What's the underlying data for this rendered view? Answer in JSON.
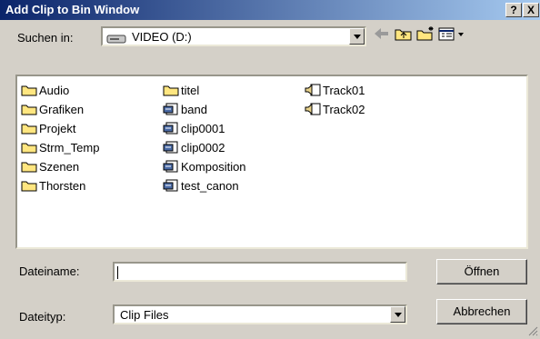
{
  "window": {
    "title": "Add Clip to Bin Window",
    "help_label": "?",
    "close_label": "X"
  },
  "lookin": {
    "label": "Suchen in:",
    "value": "VIDEO (D:)"
  },
  "toolbar": {
    "back_icon": "back-arrow-icon",
    "up_icon": "up-folder-icon",
    "newfolder_icon": "new-folder-icon",
    "view_icon": "view-menu-icon"
  },
  "files": [
    {
      "name": "Audio",
      "type": "folder"
    },
    {
      "name": "Grafiken",
      "type": "folder"
    },
    {
      "name": "Projekt",
      "type": "folder"
    },
    {
      "name": "Strm_Temp",
      "type": "folder"
    },
    {
      "name": "Szenen",
      "type": "folder"
    },
    {
      "name": "Thorsten",
      "type": "folder"
    },
    {
      "name": "titel",
      "type": "folder"
    },
    {
      "name": "band",
      "type": "clip"
    },
    {
      "name": "clip0001",
      "type": "clip"
    },
    {
      "name": "clip0002",
      "type": "clip"
    },
    {
      "name": "Komposition",
      "type": "clip"
    },
    {
      "name": "test_canon",
      "type": "clip"
    },
    {
      "name": "Track01",
      "type": "audio"
    },
    {
      "name": "Track02",
      "type": "audio"
    }
  ],
  "filename": {
    "label": "Dateiname:",
    "value": ""
  },
  "filetype": {
    "label": "Dateityp:",
    "value": "Clip Files"
  },
  "buttons": {
    "open": "Öffnen",
    "cancel": "Abbrechen"
  }
}
